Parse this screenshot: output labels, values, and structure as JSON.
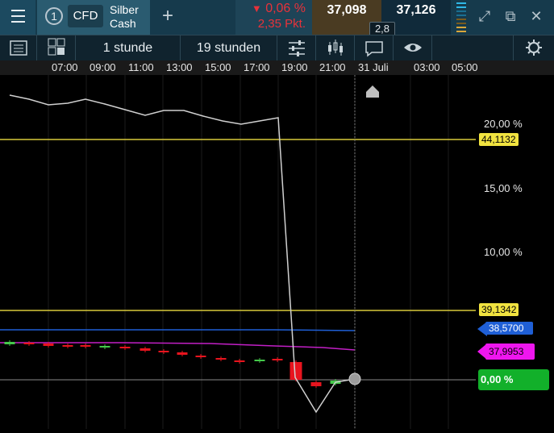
{
  "header": {
    "instrument_number": "1",
    "instrument_type": "CFD",
    "instrument_name_line1": "Silber",
    "instrument_name_line2": "Cash",
    "change_percent": "0,06 %",
    "change_points": "2,35 Pkt.",
    "bid": "37,098",
    "ask": "37,126",
    "spread": "2,8"
  },
  "toolbar": {
    "interval_label": "1 stunde",
    "range_label": "19 stunden"
  },
  "x_axis_labels": [
    "07:00",
    "09:00",
    "11:00",
    "13:00",
    "15:00",
    "17:00",
    "19:00",
    "21:00",
    "31 Juli",
    "03:00",
    "05:00"
  ],
  "y_axis_labels": [
    "20,00 %",
    "15,00 %",
    "10,00 %"
  ],
  "price_tags": {
    "upper_line": "44,1132",
    "lower_line": "39,1342",
    "blue_line": "38,5700",
    "magenta_line": "37,9953",
    "current": "0,00 %"
  },
  "colors": {
    "up_candle": "#44c94a",
    "down_candle": "#e8141e",
    "level_line": "#d8c93a",
    "blue_line": "#1f5fd6",
    "magenta_line": "#c21fc6",
    "current_tag": "#12b02a"
  },
  "chart_data": {
    "type": "line",
    "x": [
      "07:00",
      "09:00",
      "11:00",
      "13:00",
      "15:00",
      "17:00",
      "19:00",
      "21:00",
      "31 Juli",
      "03:00",
      "05:00"
    ],
    "series": [
      {
        "values": [
          22.5,
          22.2,
          21.5,
          21.8,
          21.0,
          20.6,
          20.3,
          20.0,
          -0.2,
          -0.1,
          0.0
        ]
      }
    ],
    "ytick_labels": [
      "20,00 %",
      "15,00 %",
      "10,00 %"
    ],
    "level_lines": [
      "44,1132",
      "39,1342"
    ]
  }
}
